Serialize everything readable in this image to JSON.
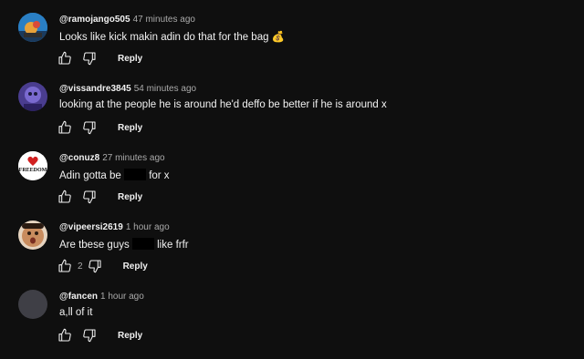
{
  "colors": {
    "background": "#0f0f0f",
    "text_primary": "#f1f1f1",
    "text_secondary": "#aaaaaa",
    "avatar_default": "#3f3f46"
  },
  "icons": {
    "like": "thumb-up-icon",
    "dislike": "thumb-down-icon"
  },
  "comments": [
    {
      "author": "@ramojango505",
      "time": "47 minutes ago",
      "text": "Looks like kick makin adin do that for the bag",
      "emoji": "💰",
      "like_count": "",
      "reply_label": "Reply"
    },
    {
      "author": "@vissandre3845",
      "time": "54 minutes ago",
      "text": "looking at the people he is around he'd deffo be better if he is around x",
      "like_count": "",
      "reply_label": "Reply"
    },
    {
      "author": "@conuz8",
      "time": "27 minutes ago",
      "text_before": "Adin gotta be",
      "text_after": "for x",
      "avatar_text": "FREEDOM",
      "like_count": "",
      "reply_label": "Reply"
    },
    {
      "author": "@vipeersi2619",
      "time": "1 hour ago",
      "text_before": "Are tbese guys",
      "text_after": "like frfr",
      "like_count": "2",
      "reply_label": "Reply"
    },
    {
      "author": "@fancen",
      "time": "1 hour ago",
      "text": "a,ll of it",
      "like_count": "",
      "reply_label": "Reply"
    }
  ]
}
